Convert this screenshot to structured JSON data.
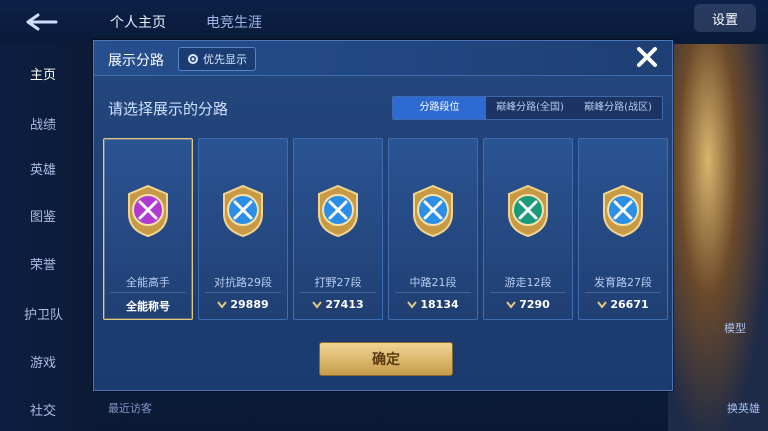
{
  "background": {
    "top_tabs": [
      "个人主页",
      "电竞生涯"
    ],
    "side_nav": [
      "主页",
      "战绩",
      "英雄",
      "图鉴",
      "荣誉",
      "护卫队",
      "游戏",
      "社交"
    ],
    "right_button": "设置",
    "right_labels": [
      "模型",
      "换英雄"
    ],
    "footer_text": "最近访客"
  },
  "modal": {
    "title": "展示分路",
    "priority_button": "优先显示",
    "subtitle": "请选择展示的分路",
    "tabs": [
      {
        "label": "分路段位",
        "active": true
      },
      {
        "label": "巅峰分路(全国)",
        "active": false
      },
      {
        "label": "巅峰分路(战区)",
        "active": false
      }
    ],
    "cards": [
      {
        "name": "全能高手",
        "value": "全能称号",
        "selected": true,
        "emblem": "all-rounder-emblem-icon",
        "color": "#b03bd1"
      },
      {
        "name": "对抗路29段",
        "value": "29889",
        "selected": false,
        "emblem": "clash-lane-emblem-icon",
        "color": "#2b8fe8"
      },
      {
        "name": "打野27段",
        "value": "27413",
        "selected": false,
        "emblem": "jungle-emblem-icon",
        "color": "#2b8fe8"
      },
      {
        "name": "中路21段",
        "value": "18134",
        "selected": false,
        "emblem": "mid-lane-emblem-icon",
        "color": "#2b8fe8"
      },
      {
        "name": "游走12段",
        "value": "7290",
        "selected": false,
        "emblem": "roam-emblem-icon",
        "color": "#1a9a7a"
      },
      {
        "name": "发育路27段",
        "value": "26671",
        "selected": false,
        "emblem": "farm-lane-emblem-icon",
        "color": "#2b8fe8"
      }
    ],
    "confirm_button": "确定",
    "colors": {
      "accent": "#2d6bd3",
      "gold": "#e3c880",
      "panel": "#1b3a6d"
    }
  }
}
